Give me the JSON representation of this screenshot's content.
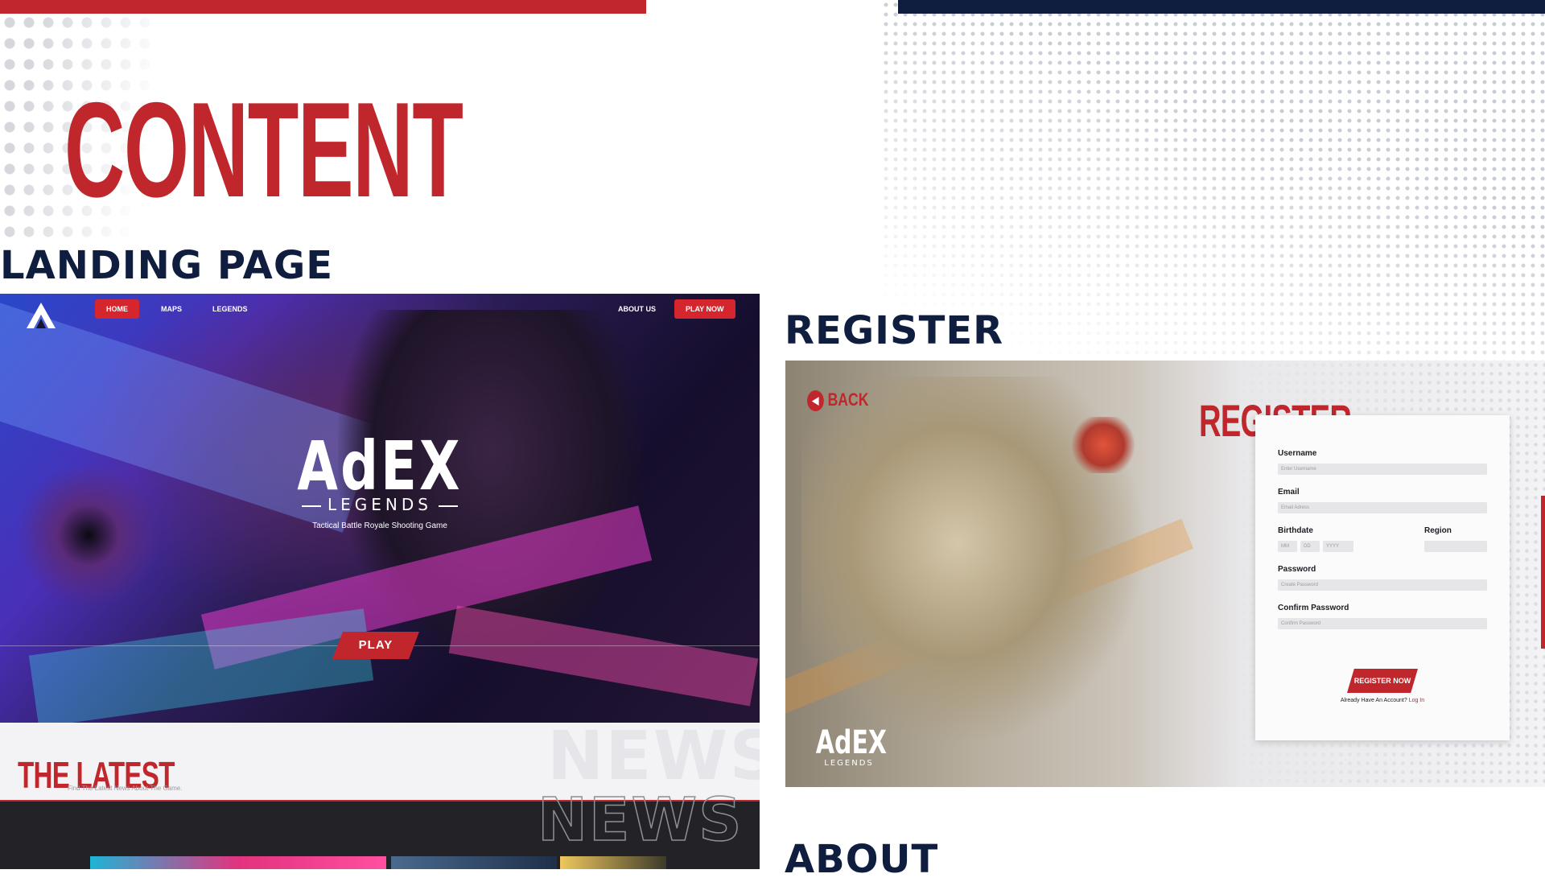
{
  "colors": {
    "accent_red": "#c0272d",
    "navy": "#0f1d3f",
    "panel": "#fbfbfc"
  },
  "header": {
    "title": "CONTENT"
  },
  "sections": {
    "landing": "LANDING PAGE",
    "register": "REGISTER",
    "about": "ABOUT"
  },
  "landing": {
    "logo_icon": "apex-logo-icon",
    "nav": {
      "home": "HOME",
      "maps": "MAPS",
      "legends": "LEGENDS",
      "about": "ABOUT US",
      "play_now": "PLAY NOW"
    },
    "hero": {
      "title": "AdEX",
      "subtitle": "LEGENDS",
      "tagline": "Tactical Battle Royale Shooting Game",
      "play": "PLAY"
    }
  },
  "latest": {
    "title": "THE LATEST",
    "subtitle": "Find The Latest News About The Game.",
    "bg_word": "NEWS"
  },
  "register": {
    "back_icon": "back-arrow-icon",
    "back": "BACK",
    "heading": "REGISTER",
    "logo_title": "AdEX",
    "logo_sub": "LEGENDS",
    "fields": {
      "username_label": "Username",
      "username_placeholder": "Enter Username",
      "email_label": "Email",
      "email_placeholder": "Email Adress",
      "birthdate_label": "Birthdate",
      "mm": "MM",
      "dd": "DD",
      "yyyy": "YYYY",
      "region_label": "Region",
      "password_label": "Password",
      "password_placeholder": "Create Password",
      "confirm_label": "Confirm Password",
      "confirm_placeholder": "Confirm Password"
    },
    "submit": "REGISTER NOW",
    "have_account": "Already Have An Account?",
    "login_link": "Log In"
  }
}
